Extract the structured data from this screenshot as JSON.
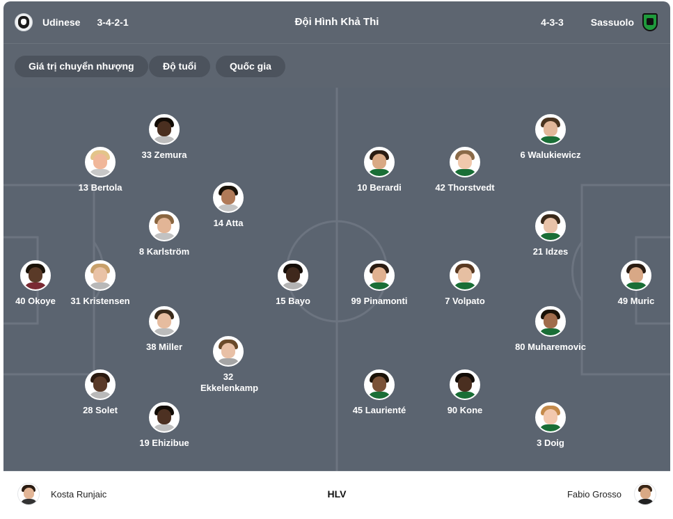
{
  "header": {
    "home_team": "Udinese",
    "home_formation": "3-4-2-1",
    "title": "Đội Hình Khả Thi",
    "away_formation": "4-3-3",
    "away_team": "Sassuolo"
  },
  "filters": [
    "Giá trị chuyển nhượng",
    "Độ tuổi",
    "Quốc gia"
  ],
  "home_players": [
    {
      "label": "40 Okoye",
      "skin": "#5a3a28",
      "hair": "#1a1208",
      "shirt": "#7a2a33"
    },
    {
      "label": "31 Kristensen",
      "skin": "#e9c2a6",
      "hair": "#c8a06a",
      "shirt": "#b8b8b8"
    },
    {
      "label": "13 Bertola",
      "skin": "#f0b79a",
      "hair": "#e3c48a",
      "shirt": "#c7c7c7"
    },
    {
      "label": "28 Solet",
      "skin": "#5a3a28",
      "hair": "#2a1a10",
      "shirt": "#b9b9b9"
    },
    {
      "label": "33 Zemura",
      "skin": "#4a2f20",
      "hair": "#120c06",
      "shirt": "#bdbdbd"
    },
    {
      "label": "8 Karlström",
      "skin": "#e2b596",
      "hair": "#8a6640",
      "shirt": "#c2c2c2"
    },
    {
      "label": "38 Miller",
      "skin": "#e6bc9f",
      "hair": "#3a2a1a",
      "shirt": "#bbbbbb"
    },
    {
      "label": "19 Ehizibue",
      "skin": "#4d3122",
      "hair": "#120c06",
      "shirt": "#c0c0c0"
    },
    {
      "label": "14 Atta",
      "skin": "#b07a58",
      "hair": "#1a1208",
      "shirt": "#c4c4c4"
    },
    {
      "label": "32 Ekkelenkamp",
      "skin": "#e8c0a6",
      "hair": "#6a4a2a",
      "shirt": "#a5a5a5"
    },
    {
      "label": "15 Bayo",
      "skin": "#3f281c",
      "hair": "#150e08",
      "shirt": "#b3b3b3"
    }
  ],
  "away_players": [
    {
      "label": "99 Pinamonti",
      "skin": "#e0b190",
      "hair": "#2a1c12",
      "shirt": "#1a6e36"
    },
    {
      "label": "7 Volpato",
      "skin": "#e6bfa2",
      "hair": "#5a3a22",
      "shirt": "#1a6e36"
    },
    {
      "label": "10 Berardi",
      "skin": "#d9a985",
      "hair": "#2a1c12",
      "shirt": "#1a6e36"
    },
    {
      "label": "42 Thorstvedt",
      "skin": "#f0c8ac",
      "hair": "#8a6a48",
      "shirt": "#1a6e36"
    },
    {
      "label": "45 Laurienté",
      "skin": "#7a5238",
      "hair": "#1a1208",
      "shirt": "#1a6e36"
    },
    {
      "label": "90 Kone",
      "skin": "#4a2f20",
      "hair": "#120c06",
      "shirt": "#1a6e36"
    },
    {
      "label": "6 Walukiewicz",
      "skin": "#e2b79a",
      "hair": "#4a3420",
      "shirt": "#1a6e36"
    },
    {
      "label": "21 Idzes",
      "skin": "#e8c2a8",
      "hair": "#3a2a1a",
      "shirt": "#1a6e36"
    },
    {
      "label": "80 Muharemovic",
      "skin": "#a06c4c",
      "hair": "#1a1208",
      "shirt": "#1a6e36"
    },
    {
      "label": "3 Doig",
      "skin": "#f2c8ae",
      "hair": "#c48a4a",
      "shirt": "#1a6e36"
    },
    {
      "label": "49 Muric",
      "skin": "#d8a886",
      "hair": "#2a1c12",
      "shirt": "#1a6e36"
    }
  ],
  "footer": {
    "home_coach": "Kosta Runjaic",
    "label": "HLV",
    "away_coach": "Fabio Grosso"
  },
  "colors": {
    "pitch": "#5b6470",
    "header": "#5d6570",
    "chip": "#4c535d",
    "pitch_lines": "#6c7480"
  }
}
